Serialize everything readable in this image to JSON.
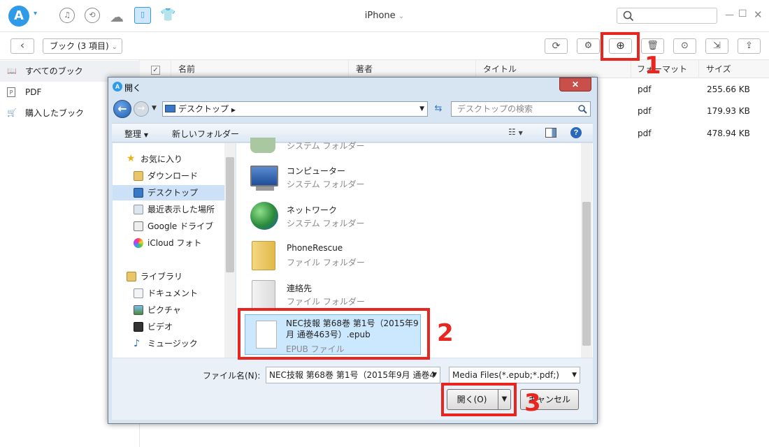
{
  "app": {
    "logo_letter": "A",
    "device_title": "iPhone",
    "brand_color": "#2f9be8"
  },
  "toolbar": {
    "back_icon": "‹",
    "category_dropdown": "ブック (3 項目)"
  },
  "sidebar": {
    "items": [
      {
        "label": "すべてのブック",
        "icon": "book-icon"
      },
      {
        "label": "PDF",
        "icon": "pdf-icon"
      },
      {
        "label": "購入したブック",
        "icon": "cart-icon"
      }
    ]
  },
  "table": {
    "columns": [
      "名前",
      "著者",
      "タイトル",
      "フォーマット",
      "サイズ"
    ],
    "rows": [
      {
        "format": "pdf",
        "size": "255.66 KB"
      },
      {
        "format": "pdf",
        "size": "179.93 KB"
      },
      {
        "format": "pdf",
        "size": "478.94 KB"
      }
    ]
  },
  "annotations": {
    "n1": "1",
    "n2": "2",
    "n3": "3",
    "color": "#e8251f"
  },
  "dialog": {
    "title": "開く",
    "close": "✕",
    "address": "デスクトップ",
    "search_placeholder": "デスクトップの検索",
    "organize": "整理",
    "new_folder": "新しいフォルダー",
    "nav": {
      "favorites": "お気に入り",
      "fav_items": [
        "ダウンロード",
        "デスクトップ",
        "最近表示した場所",
        "Google ドライブ",
        "iCloud フォト"
      ],
      "library": "ライブラリ",
      "lib_items": [
        "ドキュメント",
        "ピクチャ",
        "ビデオ",
        "ミュージック"
      ]
    },
    "files": [
      {
        "name": "システム フォルダー",
        "sub": ""
      },
      {
        "name": "コンピューター",
        "sub": "システム フォルダー"
      },
      {
        "name": "ネットワーク",
        "sub": "システム フォルダー"
      },
      {
        "name": "PhoneRescue",
        "sub": "ファイル フォルダー"
      },
      {
        "name": "連絡先",
        "sub": "ファイル フォルダー"
      },
      {
        "name": "NEC技報 第68巻 第1号（2015年9月 通巻463号）.epub",
        "sub": "EPUB ファイル"
      }
    ],
    "filename_label": "ファイル名(N):",
    "filename_value": "NEC技報 第68巻 第1号（2015年9月 通巻4",
    "filter_value": "Media Files(*.epub;*.pdf;)",
    "open_button": "開く(O)",
    "cancel_button": "キャンセル"
  }
}
